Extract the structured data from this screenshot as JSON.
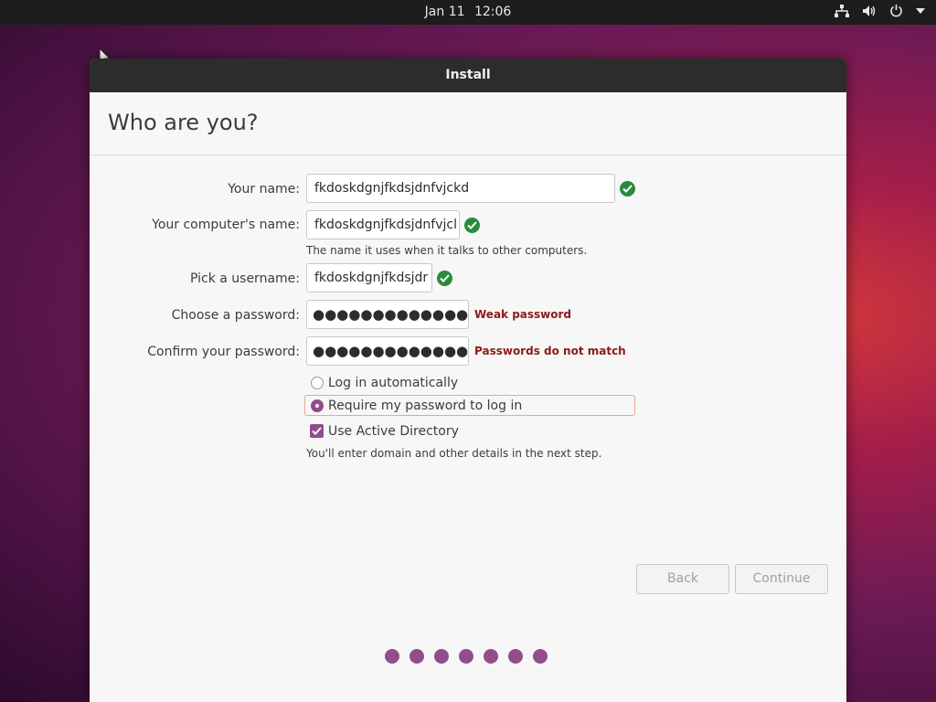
{
  "topbar": {
    "date": "Jan 11",
    "time": "12:06"
  },
  "tray_icons": [
    "network-icon",
    "volume-icon",
    "power-icon",
    "menu-arrow-icon"
  ],
  "window": {
    "title": "Install"
  },
  "page": {
    "heading": "Who are you?"
  },
  "form": {
    "name_label": "Your name:",
    "name_value": "fkdoskdgnjfkdsjdnfvjckd",
    "computer_label": "Your computer's name:",
    "computer_value": "fkdoskdgnjfkdsjdnfvjcl",
    "computer_hint": "The name it uses when it talks to other computers.",
    "username_label": "Pick a username:",
    "username_value": "fkdoskdgnjfkdsjdr",
    "password_label": "Choose a password:",
    "password_value": "●●●●●●●●●●●●●",
    "password_strength": "Weak password",
    "confirm_label": "Confirm your password:",
    "confirm_value": "●●●●●●●●●●●●●",
    "confirm_status": "Passwords do not match"
  },
  "login_options": {
    "auto_label": "Log in automatically",
    "require_label": "Require my password to log in",
    "selected": "require"
  },
  "active_directory": {
    "label": "Use Active Directory",
    "checked": true,
    "hint": "You'll enter domain and other details in the next step."
  },
  "buttons": {
    "back": "Back",
    "continue": "Continue"
  },
  "progress": {
    "total_steps": 7
  },
  "colors": {
    "accent": "#924d8b",
    "ok": "#2b8a3e",
    "error": "#8b1a1a",
    "titlebar": "#2c2c2c"
  }
}
